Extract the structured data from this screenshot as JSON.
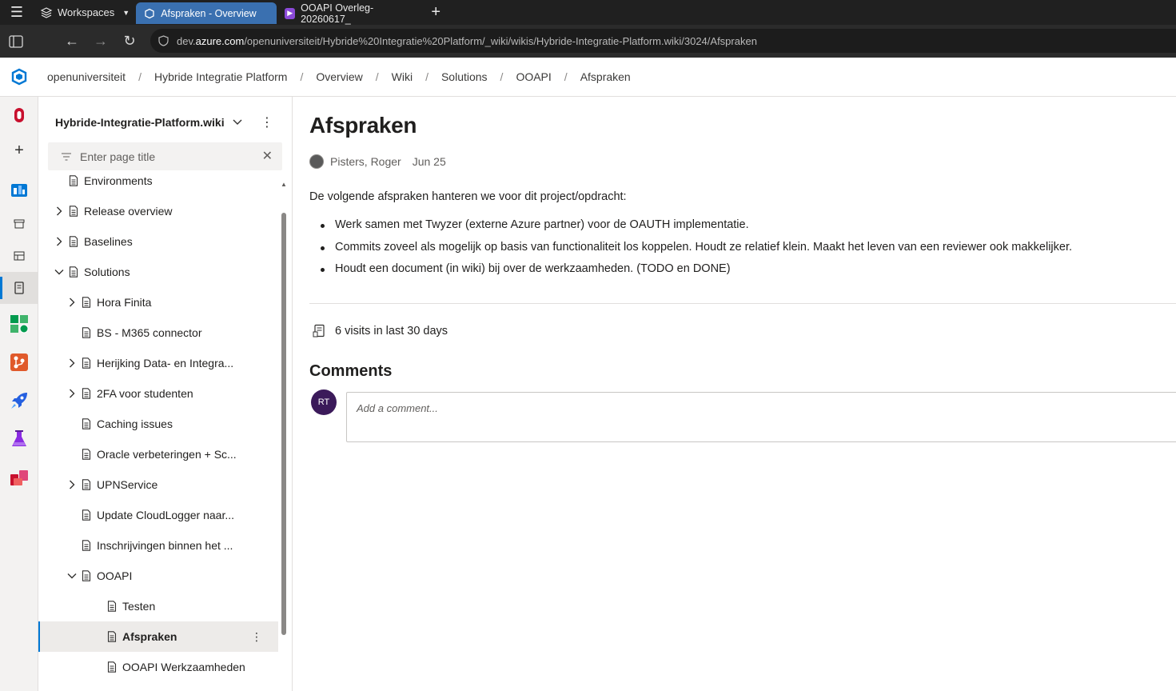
{
  "browser": {
    "workspaces_label": "Workspaces",
    "tabs": [
      {
        "label": "Afspraken - Overview",
        "active": true
      },
      {
        "label": "OOAPI Overleg-20260617_",
        "active": false
      }
    ],
    "url_prefix": "dev.",
    "url_domain": "azure.com",
    "url_path": "/openuniversiteit/Hybride%20Integratie%20Platform/_wiki/wikis/Hybride-Integratie-Platform.wiki/3024/Afspraken"
  },
  "breadcrumb": {
    "items": [
      "openuniversiteit",
      "Hybride Integratie Platform",
      "Overview",
      "Wiki",
      "Solutions",
      "OOAPI",
      "Afspraken"
    ],
    "separator": "/"
  },
  "sidebar": {
    "wiki_name": "Hybride-Integratie-Platform.wiki",
    "filter_placeholder": "Enter page title",
    "tree": [
      {
        "label": "Environments",
        "level": 1,
        "chevron": "none"
      },
      {
        "label": "Release overview",
        "level": 1,
        "chevron": "right"
      },
      {
        "label": "Baselines",
        "level": 1,
        "chevron": "right"
      },
      {
        "label": "Solutions",
        "level": 1,
        "chevron": "down"
      },
      {
        "label": "Hora Finita",
        "level": 2,
        "chevron": "right"
      },
      {
        "label": "BS - M365 connector",
        "level": 2,
        "chevron": "none"
      },
      {
        "label": "Herijking Data- en Integra...",
        "level": 2,
        "chevron": "right"
      },
      {
        "label": "2FA voor studenten",
        "level": 2,
        "chevron": "right"
      },
      {
        "label": "Caching issues",
        "level": 2,
        "chevron": "none"
      },
      {
        "label": "Oracle verbeteringen + Sc...",
        "level": 2,
        "chevron": "none"
      },
      {
        "label": "UPNService",
        "level": 2,
        "chevron": "right"
      },
      {
        "label": "Update CloudLogger naar...",
        "level": 2,
        "chevron": "none"
      },
      {
        "label": "Inschrijvingen binnen het ...",
        "level": 2,
        "chevron": "none"
      },
      {
        "label": "OOAPI",
        "level": 2,
        "chevron": "down"
      },
      {
        "label": "Testen",
        "level": 3,
        "chevron": "none"
      },
      {
        "label": "Afspraken",
        "level": 3,
        "chevron": "none",
        "selected": true
      },
      {
        "label": "OOAPI Werkzaamheden",
        "level": 3,
        "chevron": "none"
      }
    ]
  },
  "page": {
    "title": "Afspraken",
    "author": "Pisters, Roger",
    "date": "Jun 25",
    "intro": "De volgende afspraken hanteren we voor dit project/opdracht:",
    "bullets": [
      "Werk samen met Twyzer (externe Azure partner) voor de OAUTH implementatie.",
      "Commits zoveel als mogelijk op basis van functionaliteit los koppelen. Houdt ze relatief klein. Maakt het leven van een reviewer ook makkelijker.",
      "Houdt een document (in wiki) bij over de werkzaamheden. (TODO en DONE)"
    ],
    "visits": "6 visits in last 30 days"
  },
  "comments": {
    "heading": "Comments",
    "avatar_initials": "RT",
    "placeholder": "Add a comment..."
  },
  "colors": {
    "accent": "#0078d4",
    "tab_active": "#3a70b0",
    "avatar": "#3b1a5a"
  }
}
